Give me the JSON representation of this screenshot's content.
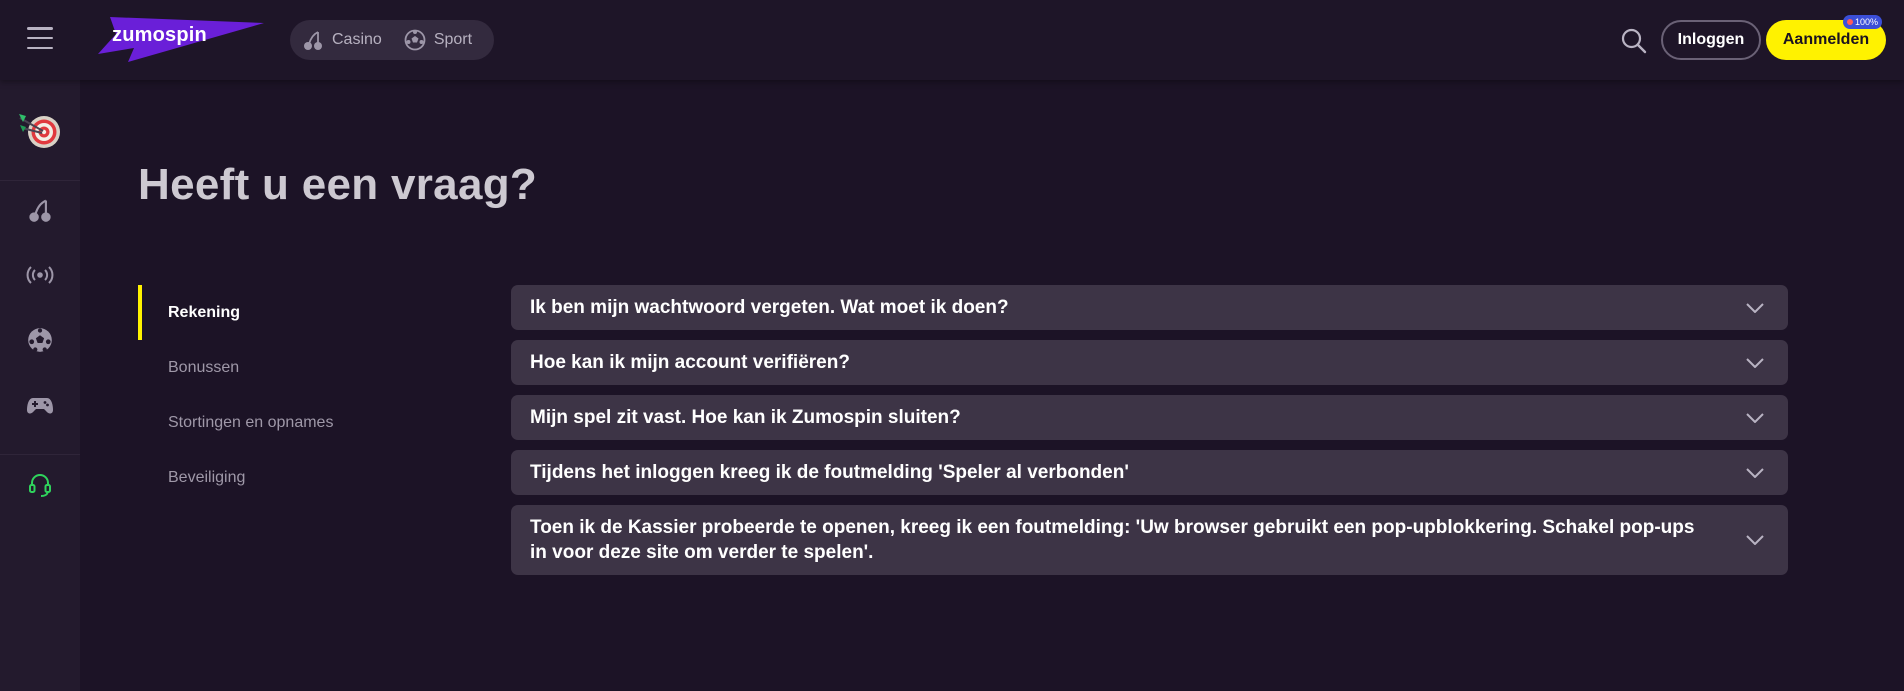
{
  "header": {
    "logo_text": "zumospin",
    "modes": [
      {
        "label": "Casino",
        "icon": "cherry-icon"
      },
      {
        "label": "Sport",
        "icon": "soccer-ball-icon"
      }
    ],
    "login_label": "Inloggen",
    "signup_label": "Aanmelden",
    "bonus_badge": "100%"
  },
  "sidebar": {
    "items": [
      {
        "icon": "dart-target-icon"
      },
      {
        "icon": "cherry-icon"
      },
      {
        "icon": "live-broadcast-icon"
      },
      {
        "icon": "soccer-ball-icon"
      },
      {
        "icon": "gamepad-icon"
      },
      {
        "icon": "headset-icon"
      }
    ]
  },
  "main": {
    "title": "Heeft u een vraag?",
    "categories": [
      {
        "label": "Rekening",
        "active": true
      },
      {
        "label": "Bonussen",
        "active": false
      },
      {
        "label": "Stortingen en opnames",
        "active": false
      },
      {
        "label": "Beveiliging",
        "active": false
      }
    ],
    "faqs": [
      {
        "question": "Ik ben mijn wachtwoord vergeten. Wat moet ik doen?"
      },
      {
        "question": "Hoe kan ik mijn account verifiëren?"
      },
      {
        "question": "Mijn spel zit vast. Hoe kan ik Zumospin sluiten?"
      },
      {
        "question": "Tijdens het inloggen kreeg ik de foutmelding 'Speler al verbonden'"
      },
      {
        "question": "Toen ik de Kassier probeerde te openen, kreeg ik een foutmelding: 'Uw browser gebruikt een pop-upblokkering. Schakel pop-ups in voor deze site om verder te spelen'."
      }
    ]
  },
  "colors": {
    "background": "#1c1326",
    "accent_yellow": "#fff200",
    "logo_purple": "#6a1fd8",
    "card": "#3d3446",
    "support_green": "#2fd35c"
  }
}
